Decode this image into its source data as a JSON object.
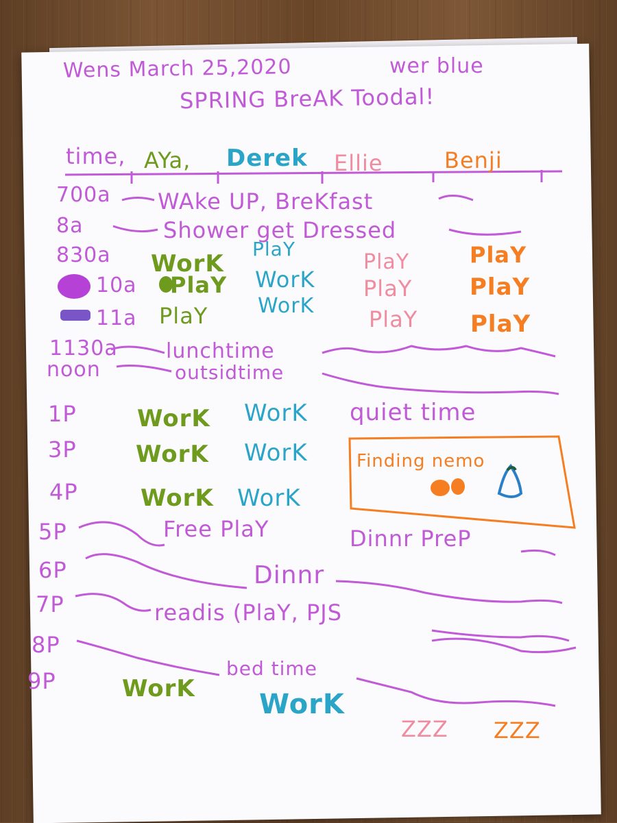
{
  "header": {
    "date": "Wens March 25,2020",
    "note": "wer blue",
    "subtitle": "SPRING BreAK Toodal!"
  },
  "columns": {
    "time": "time,",
    "aya": "AYa,",
    "derek": "Derek",
    "ellie": "Ellie",
    "benji": "Benji"
  },
  "schedule": {
    "r700_time": "700a",
    "r700_act": "WAke UP, BreKfast",
    "r8_time": "8a",
    "r8_act": "Shower get Dressed",
    "r830_time": "830a",
    "r830_aya": "WorK",
    "r830_derek": "PlaY",
    "r830_ellie": "PlaY",
    "r830_benji": "PlaY",
    "r10_time": "10a",
    "r10_aya": "PlaY",
    "r10_derek": "WorK",
    "r10_ellie": "PlaY",
    "r10_benji": "PlaY",
    "r11_time": "11a",
    "r11_aya": "PlaY",
    "r11_derek": "WorK",
    "r11_ellie": "PlaY",
    "r11_benji": "PlaY",
    "r1130_time": "1130a",
    "r1130_act": "lunchtime",
    "rnoon_time": "noon",
    "rnoon_act": "outsidtime",
    "r1p_time": "1P",
    "r1p_aya": "WorK",
    "r1p_derek": "WorK",
    "r1p_act": "quiet time",
    "r3p_time": "3P",
    "r3p_aya": "WorK",
    "r3p_derek": "WorK",
    "r3p_movie": "Finding nemo",
    "r4p_time": "4P",
    "r4p_aya": "WorK",
    "r4p_derek": "WorK",
    "r5p_time": "5P",
    "r5p_act": "Free PlaY",
    "r5p_act2": "Dinnr PreP",
    "r6p_time": "6P",
    "r6p_act": "Dinnr",
    "r7p_time": "7P",
    "r7p_act": "readis (PlaY, PJS",
    "r8p_time": "8P",
    "r9p_time": "9P",
    "r9p_act": "bed time",
    "r9p_aya": "WorK",
    "r9p_derek": "WorK",
    "r9p_ellie": "ZZZ",
    "r9p_benji": "ZZZ"
  },
  "colors": {
    "purple": "#c05ad6",
    "green": "#6e9a1e",
    "blue": "#2aa5c7",
    "pink": "#f08ca0",
    "orange": "#f57e22"
  }
}
